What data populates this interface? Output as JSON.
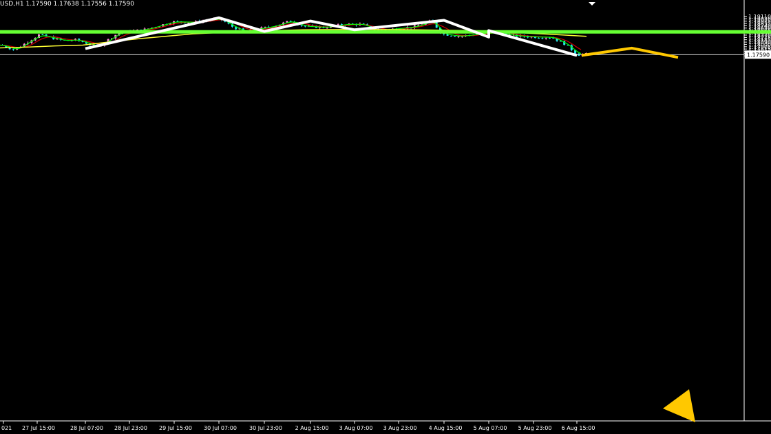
{
  "header": {
    "title": "USD,H1",
    "ohlc": "1.17590 1.17638 1.17556 1.17590"
  },
  "colors": {
    "background": "#000000",
    "candle_up": "#ff8ed6",
    "candle_down": "#29e8f0",
    "ma_fast": "#00ff00",
    "ma_mid": "#d00000",
    "ma_slow": "#ffff33",
    "level_line": "#66ff33",
    "zigzag": "#ffffff",
    "projection": "#ffc800",
    "axis": "#ffffff"
  },
  "chart_data": {
    "type": "line",
    "ylim": [
      1.175,
      1.1916
    ],
    "y_ticks": [
      "1.19110",
      "1.19020",
      "1.18925",
      "1.18835",
      "1.18740",
      "1.18650",
      "1.18555",
      "1.18460",
      "1.18370",
      "1.18275",
      "1.18185",
      "1.18090",
      "1.18000",
      "1.17905",
      "1.17815",
      "1.17720",
      "1.17630",
      "1.17540"
    ],
    "x_ticks": [
      "021",
      "27 Jul 15:00",
      "28 Jul 07:00",
      "28 Jul 23:00",
      "29 Jul 15:00",
      "30 Jul 07:00",
      "30 Jul 23:00",
      "2 Aug 15:00",
      "3 Aug 07:00",
      "3 Aug 23:00",
      "4 Aug 15:00",
      "5 Aug 07:00",
      "5 Aug 23:00",
      "6 Aug 15:00"
    ],
    "current_price": "1.17590",
    "horizontal_level": 1.185,
    "zigzag": [
      {
        "t": "28 Jul 07:00",
        "price": 1.1783
      },
      {
        "t": "30 Jul 07:00",
        "price": 1.1906
      },
      {
        "t": "30 Jul 23:00",
        "price": 1.1852
      },
      {
        "t": "2 Aug 15:00",
        "price": 1.1893
      },
      {
        "t": "3 Aug 07:00",
        "price": 1.1858
      },
      {
        "t": "4 Aug 15:00",
        "price": 1.1896
      },
      {
        "t": "5 Aug 07:00",
        "price": 1.1829
      },
      {
        "t": "5 Aug 07:00",
        "price": 1.1855
      },
      {
        "t": "6 Aug 15:00",
        "price": 1.1756
      }
    ],
    "projection": [
      {
        "t": "6 Aug 15:00",
        "price": 1.1756
      },
      {
        "price": 1.1785
      },
      {
        "price": 1.1748
      }
    ],
    "ma_slow": [
      1.1786,
      1.1789,
      1.1794,
      1.1797,
      1.181,
      1.1822,
      1.1832,
      1.1842,
      1.1847,
      1.185,
      1.1855,
      1.1858,
      1.186,
      1.1858,
      1.1854,
      1.184,
      1.1832
    ]
  }
}
